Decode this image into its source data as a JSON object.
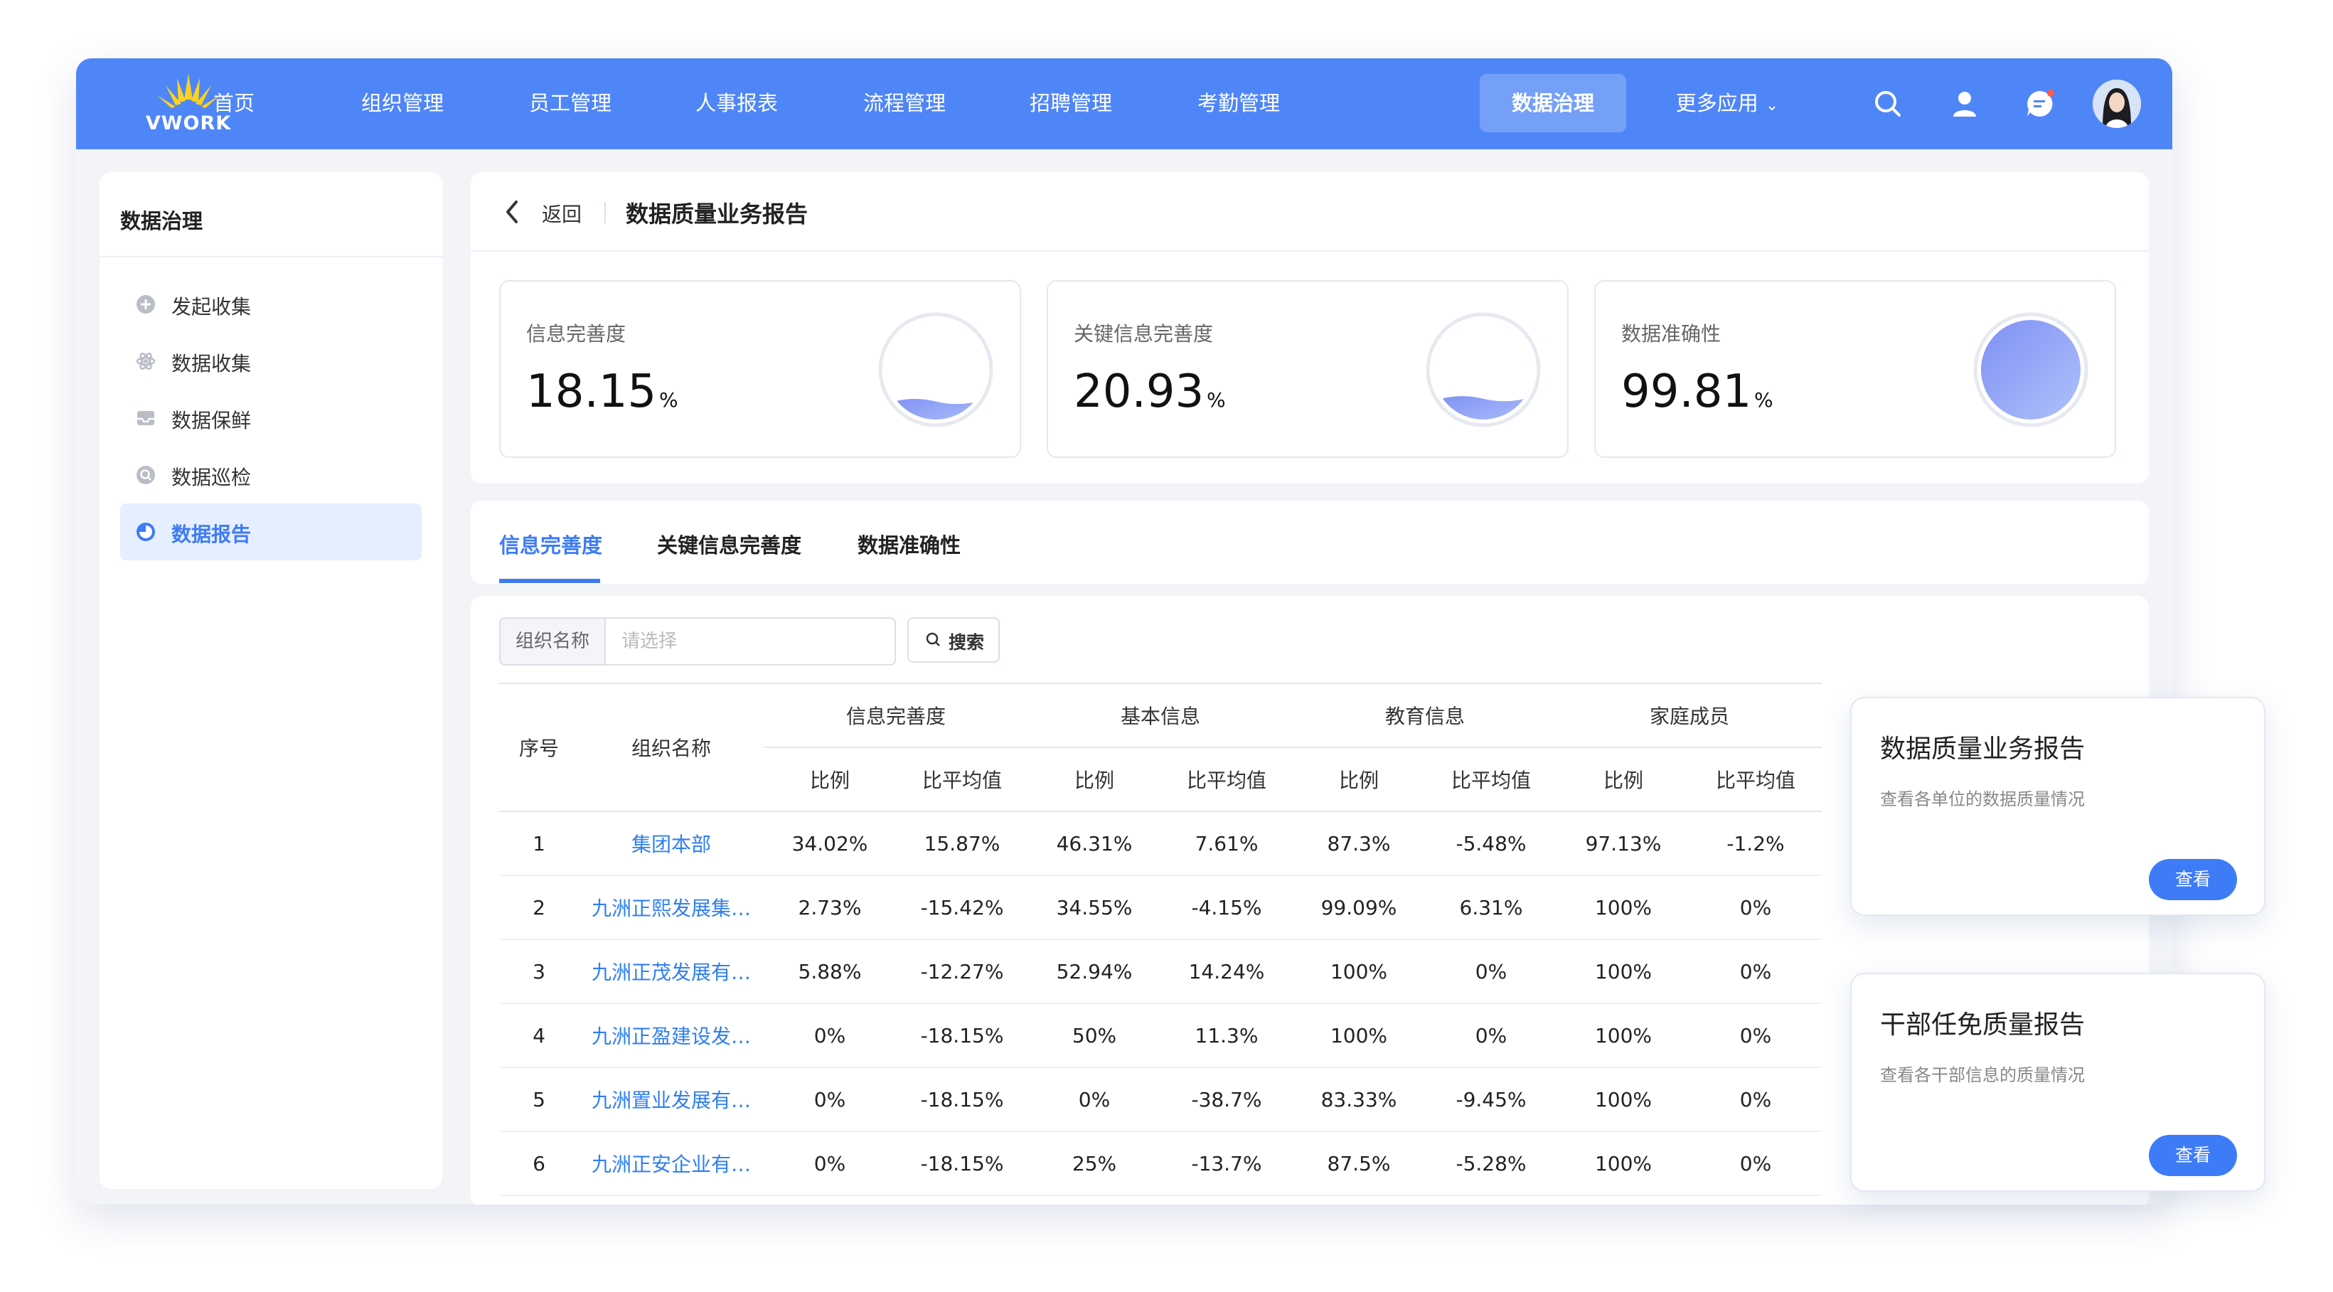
{
  "logo": {
    "text": "VWORK"
  },
  "nav": {
    "items": [
      "首页",
      "组织管理",
      "员工管理",
      "人事报表",
      "流程管理",
      "招聘管理",
      "考勤管理",
      "数据治理"
    ],
    "more": "更多应用",
    "active": "数据治理"
  },
  "top_icons": [
    "search-icon",
    "user-icon",
    "message-icon",
    "avatar"
  ],
  "sidebar": {
    "title": "数据治理",
    "items": [
      {
        "label": "发起收集",
        "icon": "plus-circle-icon"
      },
      {
        "label": "数据收集",
        "icon": "atom-icon"
      },
      {
        "label": "数据保鲜",
        "icon": "inbox-icon"
      },
      {
        "label": "数据巡检",
        "icon": "inspect-icon"
      },
      {
        "label": "数据报告",
        "icon": "pie-chart-icon",
        "active": true
      }
    ]
  },
  "header": {
    "back_label": "返回",
    "title": "数据质量业务报告"
  },
  "stats": [
    {
      "label": "信息完善度",
      "value": "18.15",
      "unit": "%",
      "fill": 0.1815
    },
    {
      "label": "关键信息完善度",
      "value": "20.93",
      "unit": "%",
      "fill": 0.2093
    },
    {
      "label": "数据准确性",
      "value": "99.81",
      "unit": "%",
      "fill": 0.9981
    }
  ],
  "tabs": [
    "信息完善度",
    "关键信息完善度",
    "数据准确性"
  ],
  "filter": {
    "label": "组织名称",
    "placeholder": "请选择",
    "search_label": "搜索"
  },
  "table": {
    "col_index": "序号",
    "col_org": "组织名称",
    "groups": [
      "信息完善度",
      "基本信息",
      "教育信息",
      "家庭成员"
    ],
    "sub_ratio": "比例",
    "sub_diff": "比平均值",
    "rows": [
      {
        "index": "1",
        "org": "集团本部",
        "cells": [
          "34.02%",
          "15.87%",
          "46.31%",
          "7.61%",
          "87.3%",
          "-5.48%",
          "97.13%",
          "-1.2%"
        ]
      },
      {
        "index": "2",
        "org": "九洲正熙发展集…",
        "cells": [
          "2.73%",
          "-15.42%",
          "34.55%",
          "-4.15%",
          "99.09%",
          "6.31%",
          "100%",
          "0%"
        ]
      },
      {
        "index": "3",
        "org": "九洲正茂发展有…",
        "cells": [
          "5.88%",
          "-12.27%",
          "52.94%",
          "14.24%",
          "100%",
          "0%",
          "100%",
          "0%"
        ]
      },
      {
        "index": "4",
        "org": "九洲正盈建设发…",
        "cells": [
          "0%",
          "-18.15%",
          "50%",
          "11.3%",
          "100%",
          "0%",
          "100%",
          "0%"
        ]
      },
      {
        "index": "5",
        "org": "九洲置业发展有…",
        "cells": [
          "0%",
          "-18.15%",
          "0%",
          "-38.7%",
          "83.33%",
          "-9.45%",
          "100%",
          "0%"
        ]
      },
      {
        "index": "6",
        "org": "九洲正安企业有…",
        "cells": [
          "0%",
          "-18.15%",
          "25%",
          "-13.7%",
          "87.5%",
          "-5.28%",
          "100%",
          "0%"
        ]
      }
    ]
  },
  "float_cards": [
    {
      "title": "数据质量业务报告",
      "desc": "查看各单位的数据质量情况",
      "button": "查看"
    },
    {
      "title": "干部任免质量报告",
      "desc": "查看各干部信息的质量情况",
      "button": "查看"
    }
  ],
  "colors": {
    "primary": "#4f86f7",
    "accent": "#3e7bf6",
    "link": "#2f7ef5",
    "gauge_fill": "#8c9df5"
  }
}
